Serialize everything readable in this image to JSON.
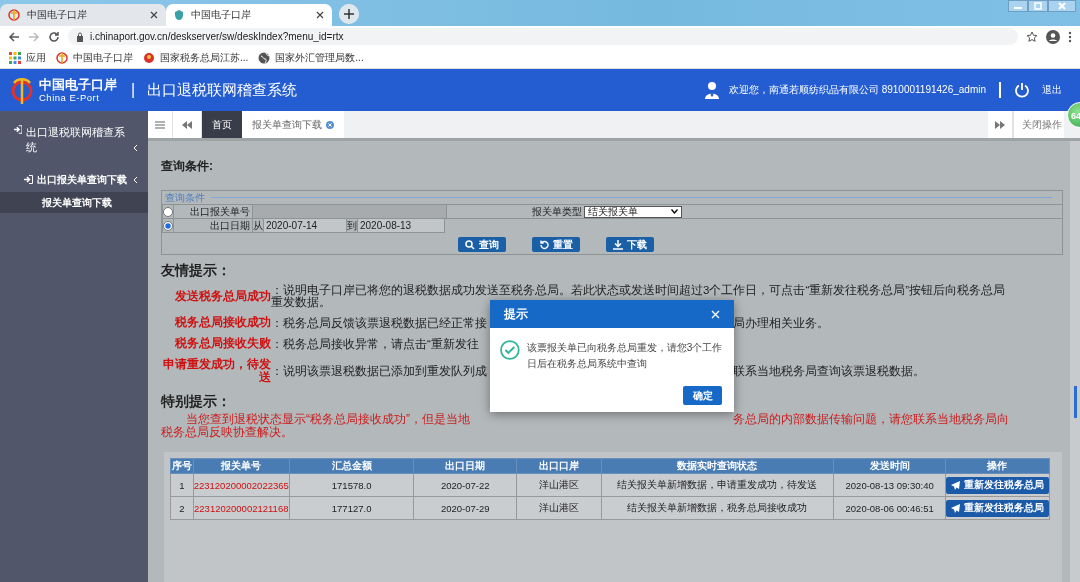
{
  "browser": {
    "tabs": [
      {
        "title": "中国电子口岸",
        "selected": false
      },
      {
        "title": "中国电子口岸",
        "selected": true
      }
    ],
    "url": "i.chinaport.gov.cn/deskserver/sw/deskIndex?menu_id=rtx",
    "bookmarks": [
      {
        "label": "应用",
        "kind": "apps"
      },
      {
        "label": "中国电子口岸",
        "kind": "eport"
      },
      {
        "label": "国家税务总局江苏...",
        "kind": "emblem"
      },
      {
        "label": "国家外汇管理局数...",
        "kind": "globe"
      }
    ]
  },
  "header": {
    "logo_cn": "中国电子口岸",
    "logo_en": "China E-Port",
    "separator": "|",
    "title": "出口退税联网稽查系统",
    "welcome": "欢迎您，南通若顺纺织品有限公司 8910001191426_admin",
    "logout": "退出"
  },
  "sidebar": {
    "items": [
      {
        "label": "出口退税联网稽查系统",
        "selected": false,
        "children": [
          {
            "label": "出口报关单查询下载",
            "selected": false,
            "children": [
              {
                "label": "报关单查询下载",
                "selected": true
              }
            ]
          }
        ]
      }
    ]
  },
  "page_tabs": {
    "tabs": [
      {
        "label": "首页",
        "selected": true,
        "closable": false
      },
      {
        "label": "报关单查询下载",
        "selected": false,
        "closable": true
      }
    ],
    "close_ops": "关闭操作",
    "badge": "64"
  },
  "query": {
    "heading": "查询条件:",
    "legend": "查询条件",
    "rows": [
      {
        "kind": "number",
        "label": "出口报关单号",
        "selected": false,
        "type_label": "报关单类型",
        "type_value": "结关报关单"
      },
      {
        "kind": "date",
        "label": "出口日期",
        "selected": true,
        "from_label": "从",
        "from": "2020-07-14",
        "to_label": "到",
        "to": "2020-08-13"
      }
    ],
    "buttons": [
      {
        "label": "查询",
        "kind": "search"
      },
      {
        "label": "重置",
        "kind": "reset"
      },
      {
        "label": "下载",
        "kind": "download"
      }
    ]
  },
  "tips": {
    "heading": "友情提示：",
    "items": [
      {
        "label": "发送税务总局成功",
        "text": "：说明电子口岸已将您的退税数据成功发送至税务总局。若此状态或发送时间超过3个工作日，可点击“重新发往税务总局”按钮后向税务总局重发数据。"
      },
      {
        "label": "税务总局接收成功",
        "text": "：税务总局反馈该票退税数据已经正常接",
        "text_right": "局办理相关业务。"
      },
      {
        "label": "税务总局接收失败",
        "text": "：税务总局接收异常，请点击“重新发往"
      },
      {
        "label": "申请重发成功，待发送",
        "text": "：说明该票退税数据已添加到重发队列成",
        "text_right": "联系当地税务局查询该票退税数据。"
      }
    ],
    "special_heading": "特别提示：",
    "special_lines": [
      {
        "text": "当您查到退税状态显示“税务总局接收成功”，但是当地",
        "text_right": "务总局的内部数据传输问题，请您联系当地税务局向"
      },
      {
        "text": "税务总局反映协查解决。"
      }
    ]
  },
  "results": {
    "columns": [
      "序号",
      "报关单号",
      "汇总金额",
      "出口日期",
      "出口口岸",
      "数据实时查询状态",
      "发送时间",
      "操作"
    ],
    "rows": [
      {
        "cells": [
          "1",
          "223120200002022365",
          "171578.0",
          "2020-07-22",
          "洋山港区",
          "结关报关单新增数据，申请重发成功，待发送",
          "2020-08-13 09:30:40"
        ],
        "action": "重新发往税务总局"
      },
      {
        "cells": [
          "2",
          "223120200002121168",
          "177127.0",
          "2020-07-29",
          "洋山港区",
          "结关报关单新增数据，税务总局接收成功",
          "2020-08-06 00:46:51"
        ],
        "action": "重新发往税务总局"
      }
    ]
  },
  "dialog": {
    "title": "提示",
    "message": "该票报关单已向税务总局重发，请您3个工作日后在税务总局系统中查询",
    "ok": "确定"
  }
}
